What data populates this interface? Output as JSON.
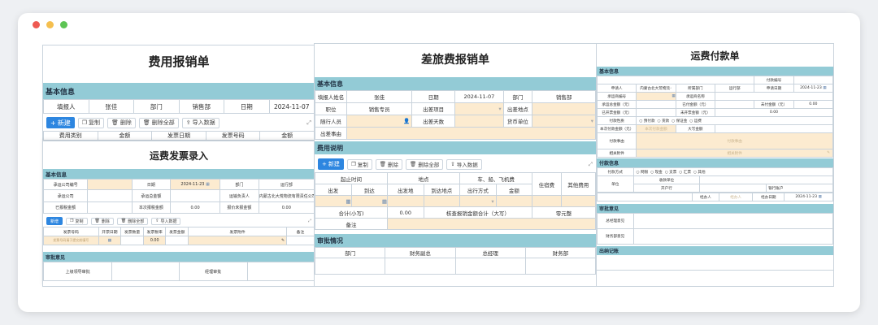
{
  "p1": {
    "title": "费用报销单",
    "section": "基本信息",
    "row": [
      "填报人",
      "张佳",
      "部门",
      "销售部",
      "日期",
      "2024-11-07"
    ],
    "buttons": [
      "新建",
      "复制",
      "删除",
      "删除全部",
      "导入数据"
    ],
    "col_heads": [
      "费用类别",
      "金额",
      "发票日期",
      "发票号码",
      "金额"
    ]
  },
  "p2": {
    "title": "运费发票录入",
    "section_basic": "基本信息",
    "r1": [
      "承运公司编号",
      "日期",
      "2024-11-23",
      "部门",
      "运行部"
    ],
    "r2": [
      "承运公司",
      "承运总金额",
      "运输负责人",
      "内蒙古北大荒物流有限责任公司..."
    ],
    "r3": [
      "已报税金额",
      "本次报税金额",
      "0.00",
      "报价未报金额",
      "0.00"
    ],
    "buttons": [
      "新增",
      "复制",
      "删除",
      "删除全部",
      "导入数据"
    ],
    "heads": [
      "发票号码",
      "开票日期",
      "发票数量",
      "发票税率",
      "发票金额",
      "发票附件",
      "备注"
    ],
    "row_rate": "0.00",
    "row_placeholder": "发票号码请于提交前填写",
    "section_approve": "审批意见",
    "approve": [
      "上级领导审批",
      "经理审批"
    ]
  },
  "p3": {
    "title": "差旅费报销单",
    "section_basic": "基本信息",
    "r1": [
      "填报人姓名",
      "张佳",
      "日期",
      "2024-11-07",
      "部门",
      "销售部"
    ],
    "r2": [
      "职位",
      "销售专员",
      "出差项目",
      "出差地点"
    ],
    "r3": [
      "随行人员",
      "出差天数",
      "货币单位"
    ],
    "r4": [
      "出差事由"
    ],
    "section_expense": "费用说明",
    "buttons": [
      "新建",
      "复制",
      "删除",
      "删除全部",
      "导入数据"
    ],
    "h1": [
      "起止时间",
      "地点",
      "车、船、飞机费",
      "住宿费",
      "其他费用"
    ],
    "h2": [
      "出发",
      "到达",
      "出发地",
      "到达地点",
      "出行方式",
      "金额"
    ],
    "total": [
      "合计(小写)",
      "0.00",
      "核查报销金额合计（大写）",
      "零元整"
    ],
    "remark": "备注",
    "section_approve": "审批情况",
    "approve": [
      "部门",
      "财务副总",
      "总经理",
      "财务部"
    ]
  },
  "p4": {
    "title": "运费付款单",
    "section_basic": "基本信息",
    "pay_no": "付款编号",
    "r1": [
      "申请人",
      "内蒙古北大荒物流",
      "所属部门",
      "运行部",
      "申请日期",
      "2024-11-23"
    ],
    "r2": [
      "承运商编号",
      "承运商名称"
    ],
    "r3": [
      "承运总金额（元）",
      "已付金额（元）",
      "未付金额（元）",
      "0.00"
    ],
    "r4": [
      "已开票金额（元）",
      "未开票金额（元）",
      "0.00"
    ],
    "r5": [
      "付款性质",
      "预付款",
      "货款",
      "保证金",
      "运费"
    ],
    "r6": [
      "本次付款金额（元）",
      "本次付款金额",
      "大写金额"
    ],
    "r7": [
      "付款事由",
      "付款事由"
    ],
    "r8": [
      "相关附件",
      "相关附件"
    ],
    "section_pay": "付款信息",
    "p1": [
      "付款方式",
      "网银",
      "现金",
      "支票",
      "汇票",
      "其他"
    ],
    "p2": [
      "单位",
      "收款单位"
    ],
    "p3": [
      "开户行",
      "银行账户"
    ],
    "p4": [
      "经办人",
      "经办人",
      "经办日期",
      "2024-11-23"
    ],
    "section_approve": "审批意见",
    "approve": [
      "总经理意见",
      "财务部意见"
    ],
    "section_out": "出纳记账"
  }
}
